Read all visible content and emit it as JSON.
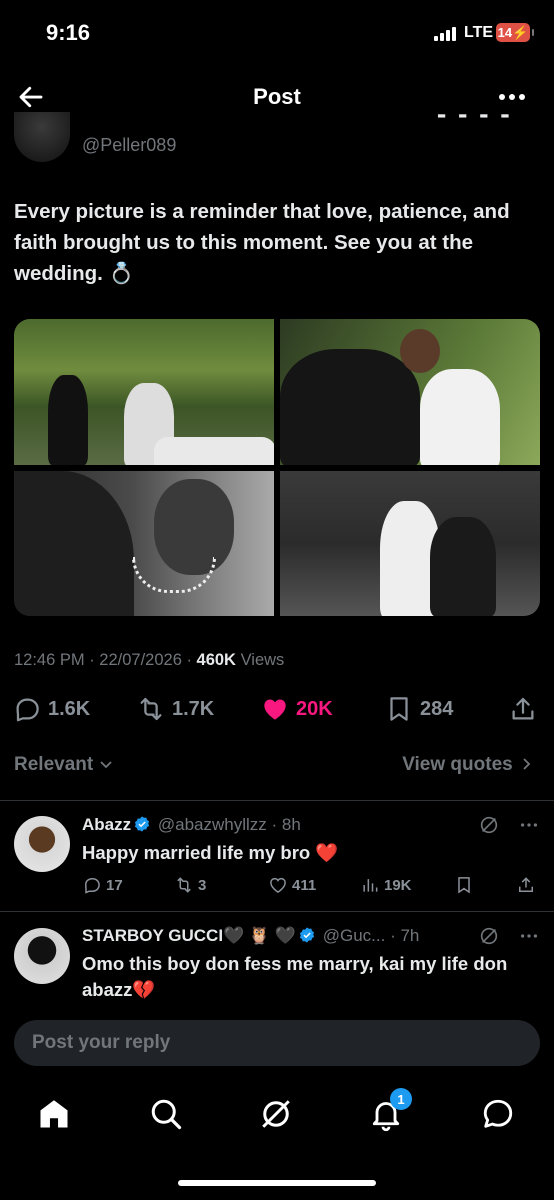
{
  "status_bar": {
    "time": "9:16",
    "network": "LTE",
    "battery": "14"
  },
  "header": {
    "title": "Post"
  },
  "post": {
    "author_handle": "@Peller089",
    "text": "Every picture is a reminder that love, patience, and faith brought us to this moment. See you at the wedding. 💍",
    "timestamp": "12:46 PM · 22/07/2026 · ",
    "views_count": "460K",
    "views_label": " Views",
    "stats": {
      "replies": "1.6K",
      "reposts": "1.7K",
      "likes": "20K",
      "bookmarks": "284"
    }
  },
  "sort": {
    "label": "Relevant",
    "view_quotes": "View quotes"
  },
  "replies": [
    {
      "name": "Abazz",
      "handle": "@abazwhyllzz",
      "time": "· 8h",
      "text": "Happy married life my bro ❤️",
      "stats": {
        "replies": "17",
        "reposts": "3",
        "likes": "411",
        "views": "19K"
      }
    },
    {
      "name": "STARBOY GUCCI🖤 🦉 🖤",
      "handle": "@Guc...",
      "time": "· 7h",
      "text": "Omo this boy don fess me marry, kai my life don abazz💔"
    }
  ],
  "reply_input": {
    "placeholder": "Post your reply"
  },
  "nav": {
    "notifications_badge": "1"
  },
  "colors": {
    "accent": "#1d9bf0",
    "like": "#f91880",
    "muted": "#71767b"
  }
}
